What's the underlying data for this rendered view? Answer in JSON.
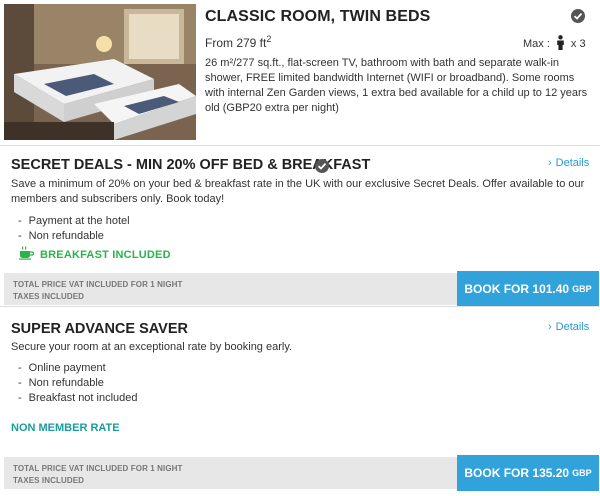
{
  "room": {
    "title": "CLASSIC ROOM, TWIN BEDS",
    "from_prefix": "From 279 ft",
    "from_exponent": "2",
    "max_label": "Max :",
    "max_value": "x 3",
    "description": "26 m²/277 sq.ft., flat-screen TV, bathroom with bath and separate walk-in shower, FREE limited bandwidth Internet (WIFI or broadband). Some rooms with internal Zen Garden views, 1 extra bed available for a child up to 12 years old (GBP20 extra per night)"
  },
  "offers": [
    {
      "title": "SECRET DEALS - MIN 20% OFF BED & BREAKFAST",
      "details_label": "Details",
      "description": "Save a minimum of 20% on your bed & breakfast rate in the UK with our exclusive Secret Deals. Offer available to our members and subscribers only. Book today!",
      "conditions": [
        "Payment at the hotel",
        "Non refundable"
      ],
      "badge": "BREAKFAST INCLUDED",
      "price_line1": "TOTAL PRICE VAT INCLUDED FOR 1 NIGHT",
      "price_line2": "TAXES INCLUDED",
      "book_label": "BOOK FOR 101.40",
      "currency": "GBP"
    },
    {
      "title": "SUPER ADVANCE SAVER",
      "details_label": "Details",
      "description": "Secure your room at an exceptional rate by booking early.",
      "conditions": [
        "Online payment",
        "Non refundable",
        "Breakfast not included"
      ],
      "rate_label": "NON MEMBER RATE",
      "price_line1": "TOTAL PRICE VAT INCLUDED FOR 1 NIGHT",
      "price_line2": "TAXES INCLUDED",
      "book_label": "BOOK FOR 135.20",
      "currency": "GBP"
    }
  ],
  "colors": {
    "accent": "#32a2db",
    "badge_green": "#2bb24c",
    "rate_teal": "#1a9e9b"
  },
  "icons": [
    "check-badge-icon",
    "person-icon",
    "coffee-cup-icon",
    "chevron-right-icon"
  ]
}
